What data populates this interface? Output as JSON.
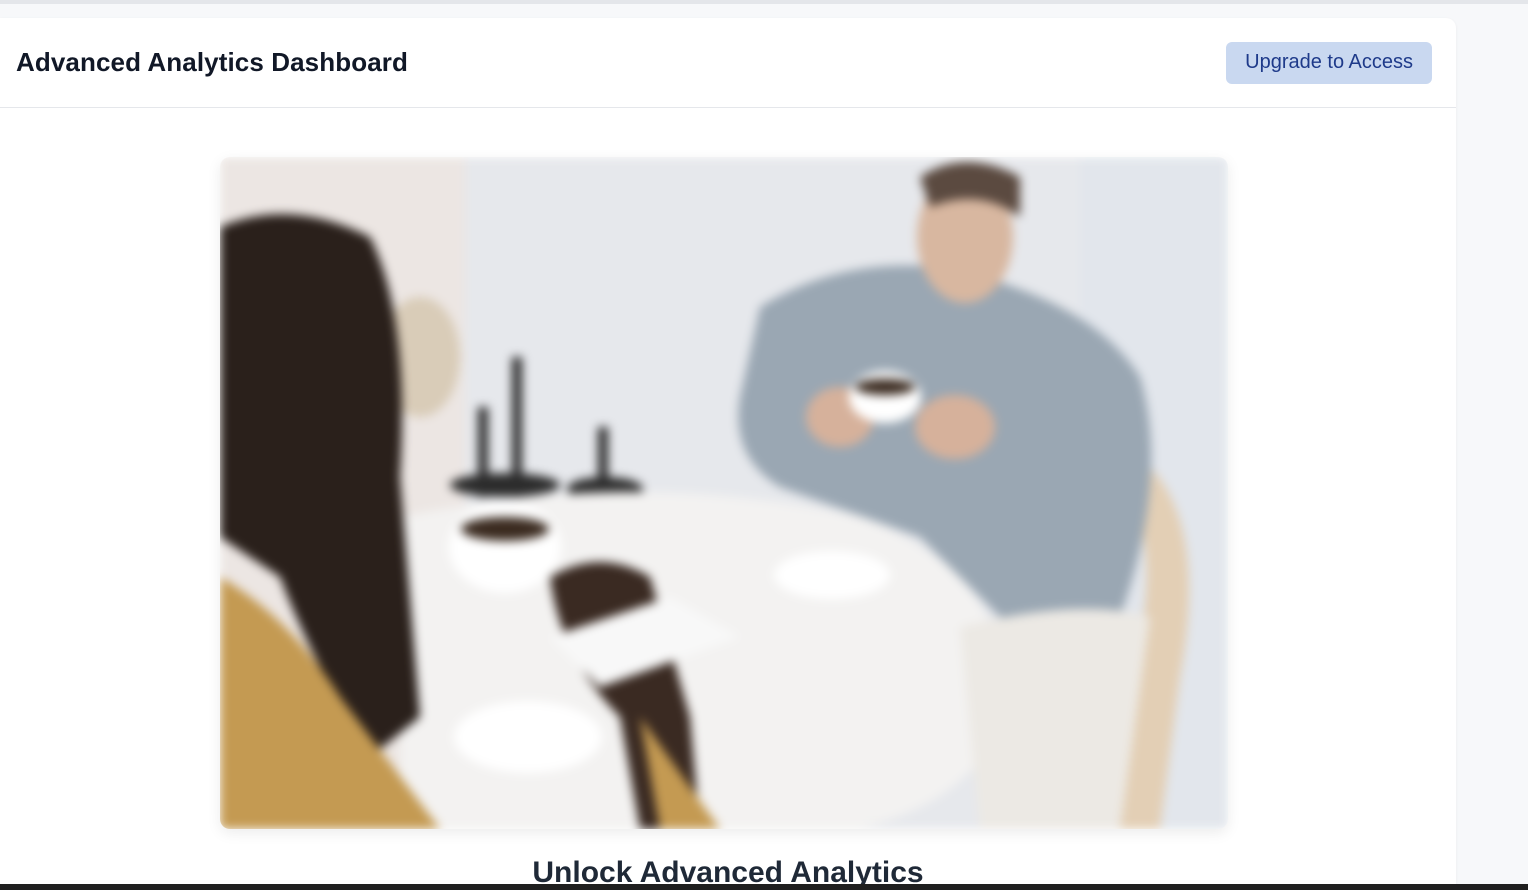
{
  "header": {
    "title": "Advanced Analytics Dashboard",
    "upgrade_label": "Upgrade to Access"
  },
  "hero": {
    "image_icon": "blurred-photo-two-people-coffee"
  },
  "content": {
    "unlock_title": "Unlock Advanced Analytics"
  },
  "colors": {
    "button_bg": "#c9d8f0",
    "button_text": "#1e3a8a",
    "title_text": "#111827"
  }
}
